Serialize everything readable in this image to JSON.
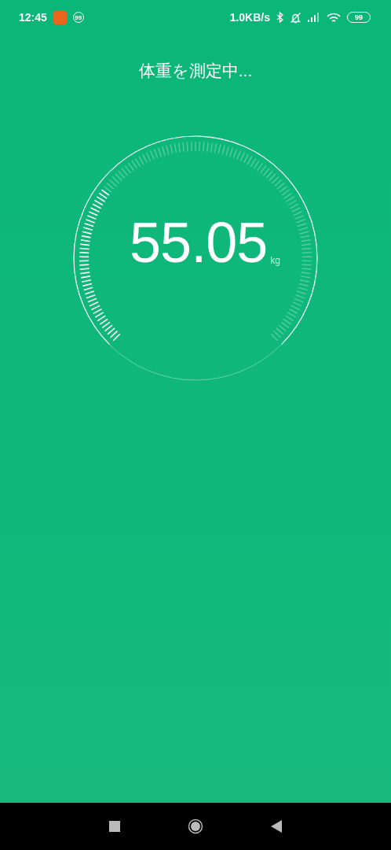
{
  "status_bar": {
    "time": "12:45",
    "notification_badge": "99",
    "net_speed": "1.0KB/s",
    "battery": "99"
  },
  "title": "体重を測定中...",
  "gauge": {
    "value": "55.05",
    "unit": "kg"
  }
}
